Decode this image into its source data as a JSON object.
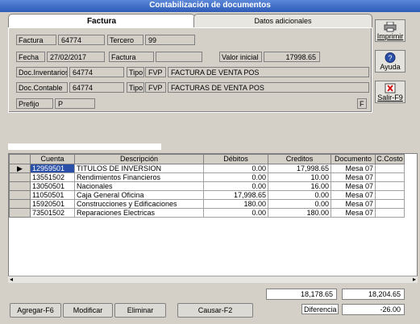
{
  "window": {
    "title": "Contabilización de  documentos"
  },
  "tabs": [
    {
      "label": "Factura"
    },
    {
      "label": "Datos adicionales"
    }
  ],
  "form": {
    "factura_label": "Factura",
    "factura_value": "64774",
    "tercero_label": "Tercero",
    "tercero_value": "99",
    "fecha_label": "Fecha",
    "fecha_value": "27/02/2017",
    "factura2_label": "Factura",
    "factura2_value": "",
    "valor_label": "Valor inicial",
    "valor_value": "17998.65",
    "docinv_label": "Doc.Inventarios",
    "docinv_value": "64774",
    "tipo1_label": "Tipo",
    "tipo1_code": "FVP",
    "tipo1_desc": "FACTURA DE VENTA POS",
    "doccont_label": "Doc.Contable",
    "doccont_value": "64774",
    "tipo2_label": "Tipo",
    "tipo2_code": "FVP",
    "tipo2_desc": "FACTURAS DE VENTA POS",
    "prefijo_label": "Prefijo",
    "prefijo_value": "P",
    "flag_value": "F"
  },
  "sidebar": {
    "print_label": "Imprimir",
    "help_label": "Ayuda",
    "exit_label": "Salir-F9"
  },
  "grid": {
    "headers": [
      "Cuenta",
      "Descripción",
      "Débitos",
      "Creditos",
      "Documento",
      "C.Costo"
    ],
    "rows": [
      {
        "cuenta": "12959501",
        "descripcion": "TITULOS DE INVERSION",
        "debitos": "0.00",
        "creditos": "17,998.65",
        "documento": "Mesa 07",
        "ccosto": ""
      },
      {
        "cuenta": "13551502",
        "descripcion": "Rendimientos Financieros",
        "debitos": "0.00",
        "creditos": "10.00",
        "documento": "Mesa 07",
        "ccosto": ""
      },
      {
        "cuenta": "13050501",
        "descripcion": "Nacionales",
        "debitos": "0.00",
        "creditos": "16.00",
        "documento": "Mesa 07",
        "ccosto": ""
      },
      {
        "cuenta": "11050501",
        "descripcion": "Caja General Oficina",
        "debitos": "17,998.65",
        "creditos": "0.00",
        "documento": "Mesa 07",
        "ccosto": ""
      },
      {
        "cuenta": "15920501",
        "descripcion": "Construcciones y Edificaciones",
        "debitos": "180.00",
        "creditos": "0.00",
        "documento": "Mesa 07",
        "ccosto": ""
      },
      {
        "cuenta": "73501502",
        "descripcion": "Reparaciones Electricas",
        "debitos": "0.00",
        "creditos": "180.00",
        "documento": "Mesa 07",
        "ccosto": ""
      }
    ]
  },
  "totals": {
    "debitos": "18,178.65",
    "creditos": "18,204.65",
    "diferencia_label": "Diferencia",
    "diferencia_value": "-26.00"
  },
  "actions": {
    "agregar": "Agregar-F6",
    "modificar": "Modificar",
    "eliminar": "Eliminar",
    "causar": "Causar-F2"
  }
}
